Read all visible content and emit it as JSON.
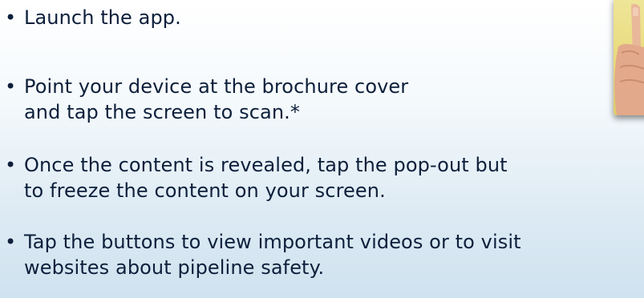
{
  "bullets": [
    {
      "marker": "•",
      "line1": "Launch the app.",
      "line2": ""
    },
    {
      "marker": "•",
      "line1": "Point your device at the brochure cover",
      "line2": "and tap the screen to scan.*"
    },
    {
      "marker": "•",
      "line1": "Once the content is revealed, tap the pop-out but",
      "line2": "to freeze the content on your screen."
    },
    {
      "marker": "•",
      "line1": "Tap the buttons to view important videos or to visit",
      "line2": "websites about pipeline safety."
    }
  ],
  "colors": {
    "text": "#0d1f3b",
    "background_top": "#ffffff",
    "background_bottom": "#cfe2ef",
    "photo_background": "#e8d979",
    "skin": "#e9b79a"
  },
  "image": {
    "subject": "finger-tapping-device-photo"
  }
}
